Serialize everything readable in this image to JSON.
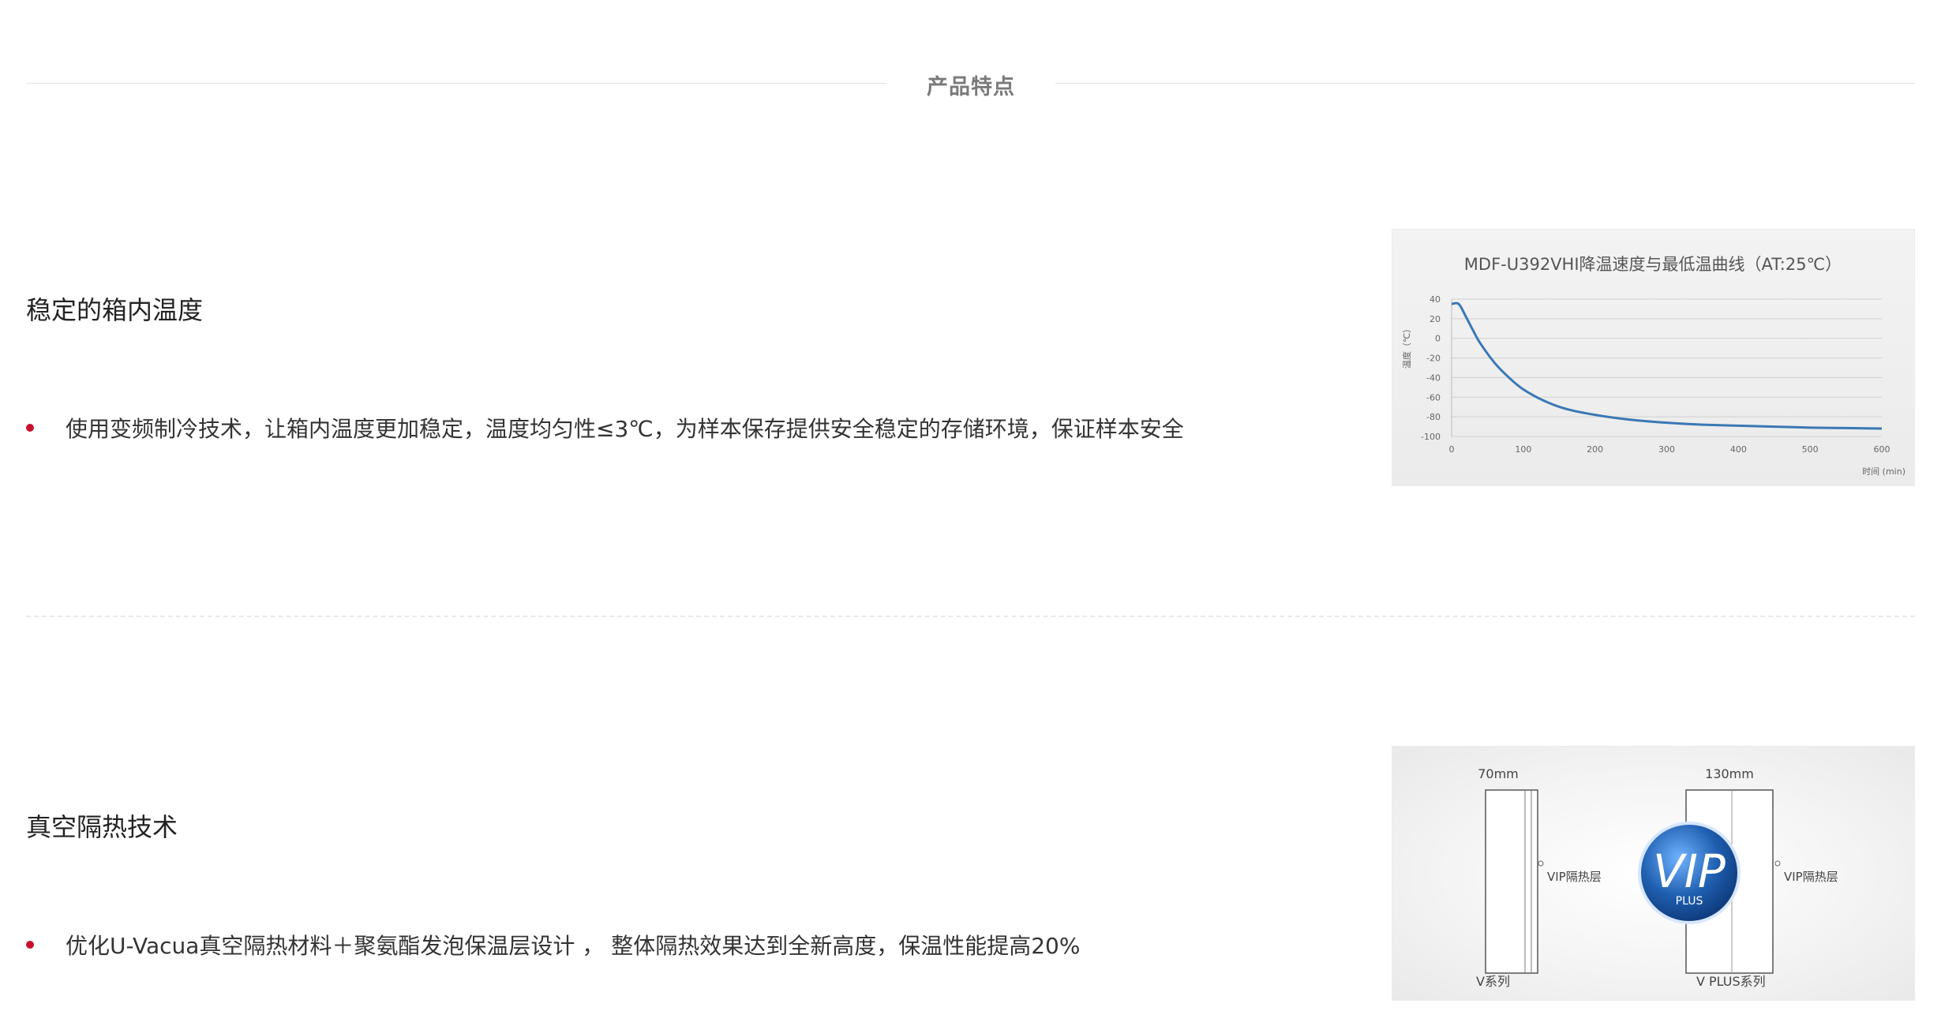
{
  "section": {
    "title": "产品特点"
  },
  "features": [
    {
      "title": "稳定的箱内温度",
      "bullet": "使用变频制冷技术，让箱内温度更加稳定，温度均匀性≤3℃，为样本保存提供安全稳定的存储环境，保证样本安全"
    },
    {
      "title": "真空隔热技术",
      "bullet": "优化U-Vacua真空隔热材料＋聚氨酯发泡保温层设计 ， 整体隔热效果达到全新高度，保温性能提高20%"
    }
  ],
  "colors": {
    "bullet": "#c8102e",
    "curve": "#3a78b5",
    "vip_blue": "#1f5fb0"
  },
  "chart_data": {
    "type": "line",
    "title": "MDF-U392VHI降温速度与最低温曲线（AT:25℃）",
    "ylabel": "温度（℃）",
    "xlabel": "时间 (min)",
    "xlim": [
      0,
      600
    ],
    "ylim": [
      -100,
      40
    ],
    "x_ticks": [
      "0",
      "100",
      "200",
      "300",
      "400",
      "500",
      "600"
    ],
    "y_ticks": [
      "40",
      "20",
      "0",
      "-20",
      "-40",
      "-60",
      "-80",
      "-100"
    ],
    "grid": true,
    "x": [
      0,
      10,
      20,
      30,
      40,
      60,
      80,
      100,
      130,
      160,
      200,
      250,
      300,
      350,
      400,
      450,
      500,
      550,
      600
    ],
    "values": [
      35,
      35,
      22,
      8,
      -5,
      -25,
      -40,
      -52,
      -64,
      -72,
      -78,
      -83,
      -86,
      -88,
      -89,
      -90,
      -91,
      -91.5,
      -92
    ]
  },
  "diagram": {
    "left_width": "70mm",
    "right_width": "130mm",
    "left_layer": "VIP隔热层",
    "right_layer": "VIP隔热层",
    "left_series": "V系列",
    "right_series": "V PLUS系列",
    "badge_main": "VIP",
    "badge_sub": "PLUS"
  }
}
